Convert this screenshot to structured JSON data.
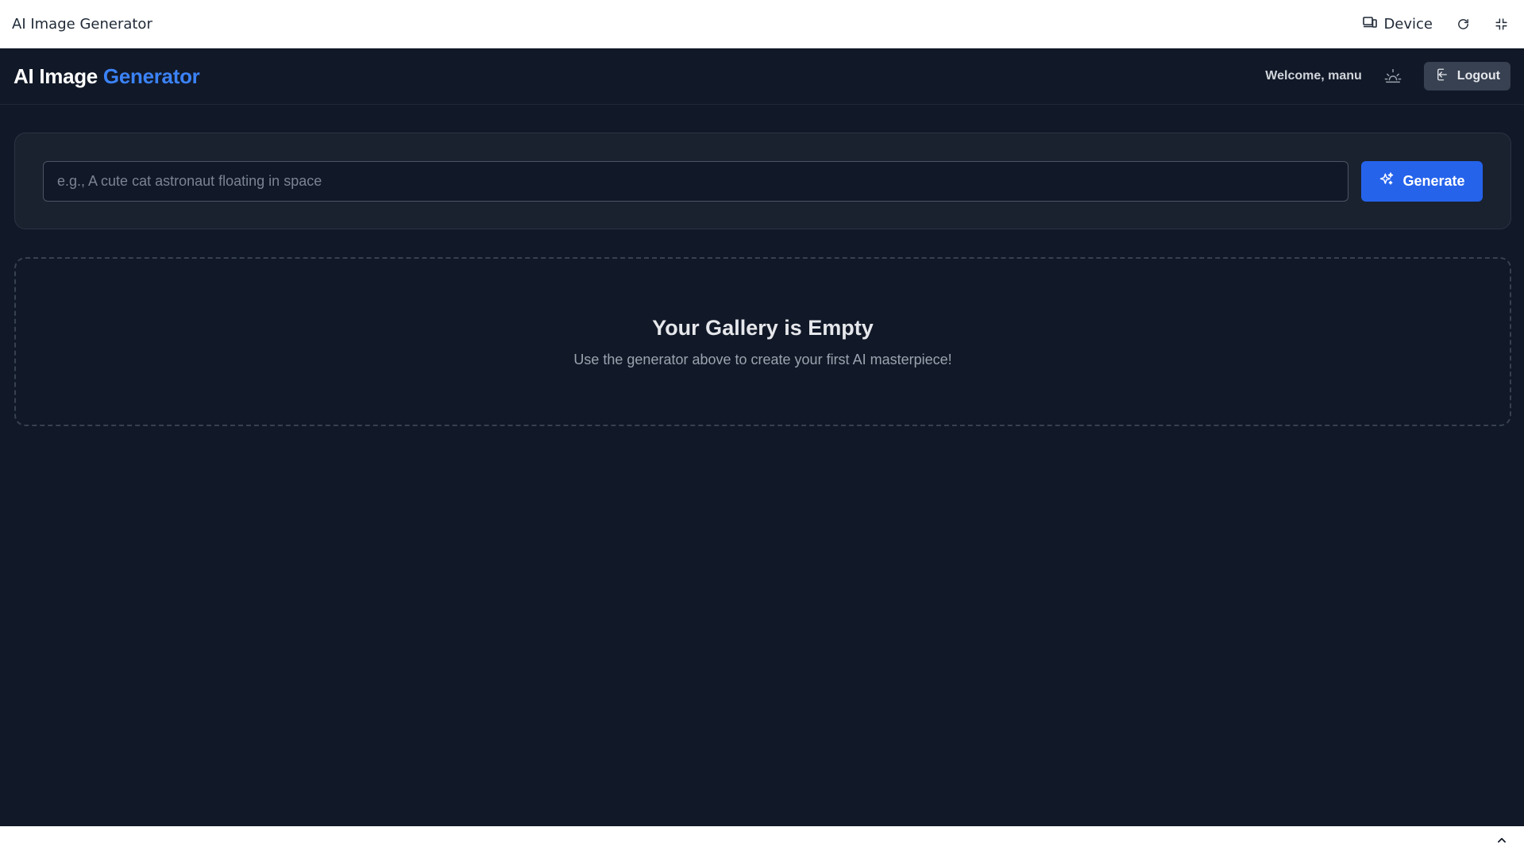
{
  "frame": {
    "title": "AI Image Generator",
    "device_label": "Device",
    "icons": [
      "device-icon",
      "refresh-icon",
      "fullscreen-icon",
      "chevron-up-icon"
    ]
  },
  "header": {
    "brand_main": "AI Image ",
    "brand_accent": "Generator",
    "welcome_text": "Welcome, manu",
    "logout_label": "Logout",
    "icons": [
      "theme-toggle-icon",
      "logout-icon"
    ]
  },
  "generator": {
    "prompt_placeholder": "e.g., A cute cat astronaut floating in space",
    "prompt_value": "",
    "generate_label": "Generate",
    "icon": "sparkles-icon"
  },
  "gallery": {
    "empty_title": "Your Gallery is Empty",
    "empty_subtitle": "Use the generator above to create your first AI masterpiece!"
  },
  "colors": {
    "app_background": "#111827",
    "accent": "#3b82f6",
    "primary_button": "#2563eb",
    "card_background": "#1a2230"
  }
}
